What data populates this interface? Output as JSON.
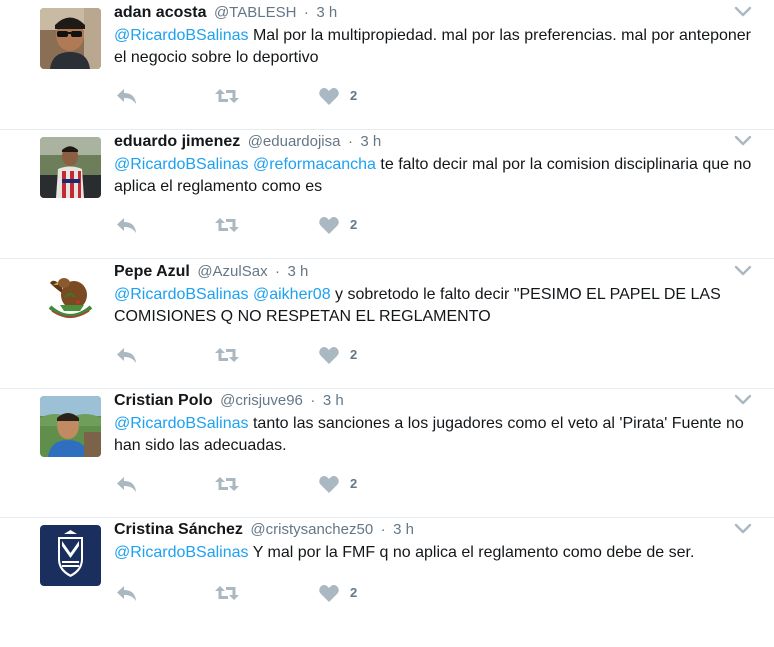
{
  "colors": {
    "mention": "#1da1f2",
    "secondary_text": "#657786",
    "action_icon": "#aab8c2",
    "divider": "#e6ecf0"
  },
  "tweets": [
    {
      "fullname": "adan acosta",
      "screenname": "@TABLESH",
      "separator": "·",
      "time": "3 h",
      "mentions": [
        "@RicardoBSalinas"
      ],
      "text": " Mal por la multipropiedad. mal por las preferencias. mal por anteponer el negocio sobre lo deportivo",
      "likes": "2",
      "avatar_icon": "profile-photo-man-sunglasses"
    },
    {
      "fullname": "eduardo jimenez",
      "screenname": "@eduardojisa",
      "separator": "·",
      "time": "3 h",
      "mentions": [
        "@RicardoBSalinas",
        "@reformacancha"
      ],
      "text": " te falto decir mal por la comision disciplinaria que no aplica el reglamento como es",
      "likes": "2",
      "avatar_icon": "profile-photo-jersey"
    },
    {
      "fullname": "Pepe Azul",
      "screenname": "@AzulSax",
      "separator": "·",
      "time": "3 h",
      "mentions": [
        "@RicardoBSalinas",
        "@aikher08"
      ],
      "text": " y sobretodo le falto decir \"PESIMO EL PAPEL DE LAS COMISIONES Q NO RESPETAN EL REGLAMENTO",
      "likes": "2",
      "avatar_icon": "mexican-eagle-emblem"
    },
    {
      "fullname": "Cristian Polo",
      "screenname": "@crisjuve96",
      "separator": "·",
      "time": "3 h",
      "mentions": [
        "@RicardoBSalinas"
      ],
      "text": " tanto las sanciones a los jugadores como el veto al 'Pirata' Fuente no han sido las adecuadas.",
      "likes": "2",
      "avatar_icon": "profile-photo-outdoors"
    },
    {
      "fullname": "Cristina Sánchez",
      "screenname": "@cristysanchez50",
      "separator": "·",
      "time": "3 h",
      "mentions": [
        "@RicardoBSalinas"
      ],
      "text": " Y mal por la FMF q no aplica el reglamento como debe de ser.",
      "likes": "2",
      "avatar_icon": "monterrey-shield-logo"
    }
  ]
}
